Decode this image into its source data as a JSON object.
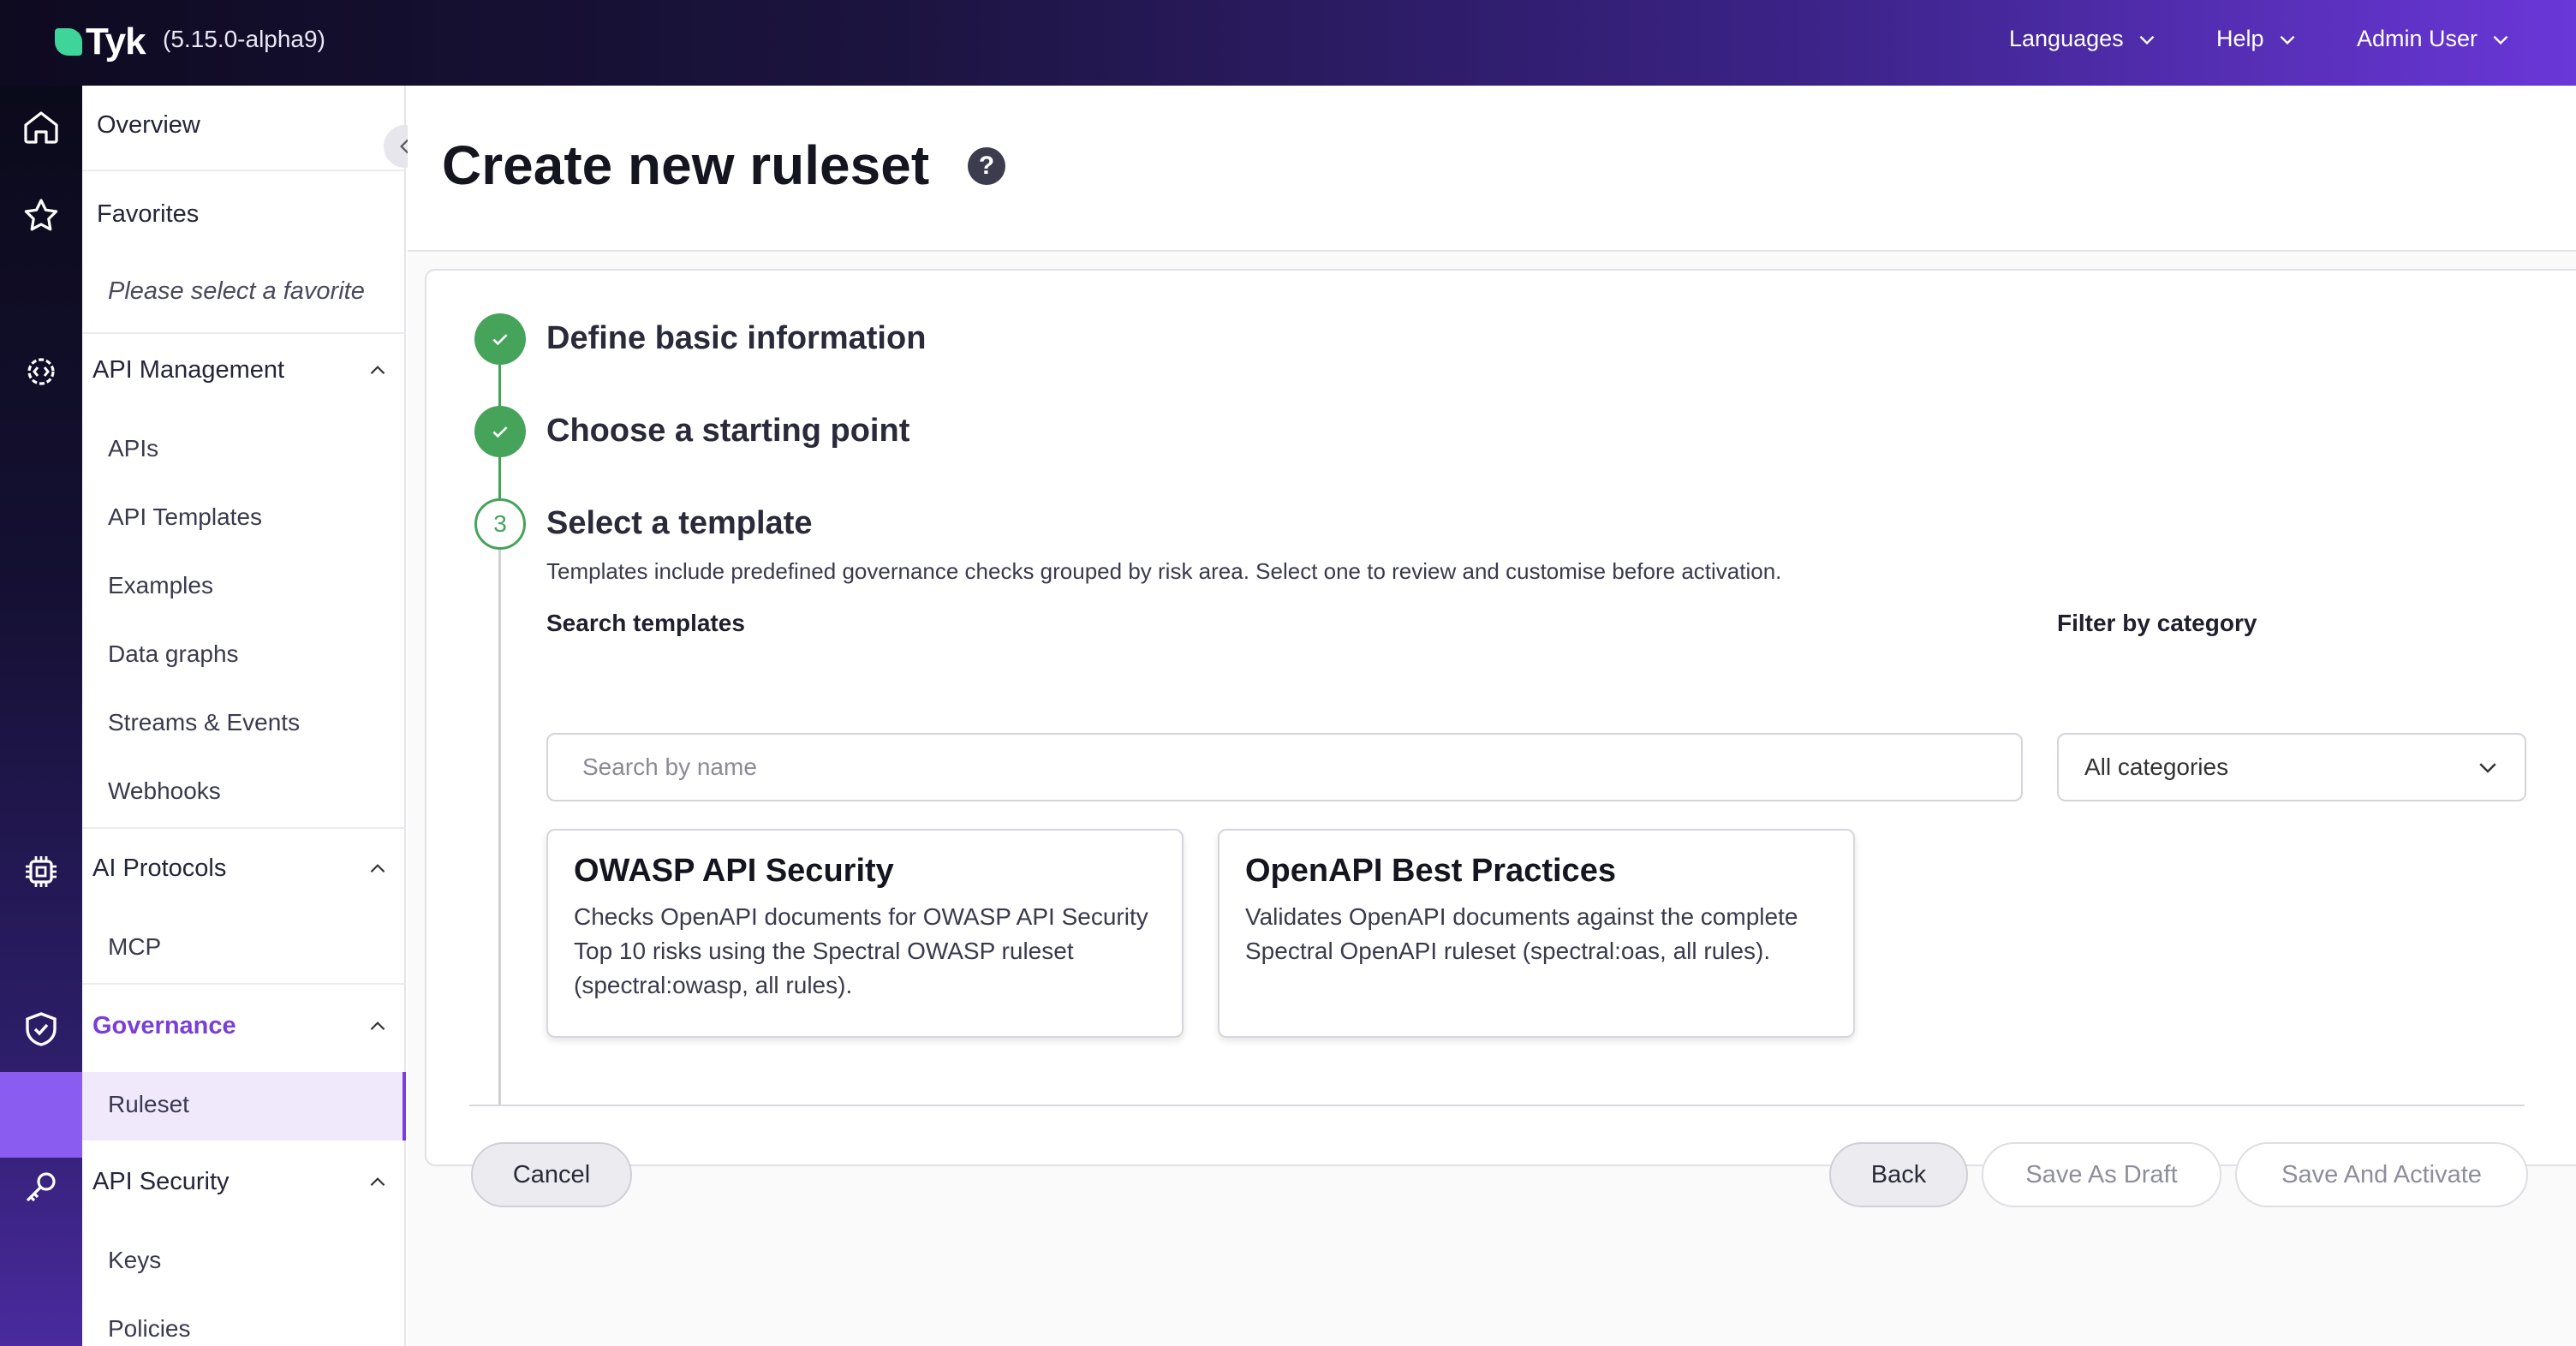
{
  "topbar": {
    "logo_text": "Tyk",
    "version": "(5.15.0-alpha9)",
    "languages_label": "Languages",
    "help_label": "Help",
    "user_label": "Admin User"
  },
  "rail": {
    "icons": [
      "home-icon",
      "star-icon",
      "gear-code-icon",
      "chip-icon",
      "shield-check-icon",
      "key-icon"
    ]
  },
  "sidebar": {
    "overview": "Overview",
    "favorites": "Favorites",
    "favorites_placeholder": "Please select a favorite",
    "api_management": {
      "label": "API Management",
      "items": [
        "APIs",
        "API Templates",
        "Examples",
        "Data graphs",
        "Streams & Events",
        "Webhooks"
      ]
    },
    "ai_protocols": {
      "label": "AI Protocols",
      "items": [
        "MCP"
      ]
    },
    "governance": {
      "label": "Governance",
      "items": [
        "Ruleset"
      ]
    },
    "api_security": {
      "label": "API Security",
      "items": [
        "Keys",
        "Policies"
      ]
    }
  },
  "page": {
    "title": "Create new ruleset",
    "help": "?"
  },
  "steps": [
    {
      "title": "Define basic information",
      "status": "done"
    },
    {
      "title": "Choose a starting point",
      "status": "done"
    },
    {
      "number": "3",
      "title": "Select a template",
      "status": "current",
      "description": "Templates include predefined governance checks grouped by risk area. Select one to review and customise before activation."
    }
  ],
  "search": {
    "label": "Search templates",
    "placeholder": "Search by name"
  },
  "filter": {
    "label": "Filter by category",
    "value": "All categories"
  },
  "templates": [
    {
      "title": "OWASP API Security",
      "description": "Checks OpenAPI documents for OWASP API Security Top 10 risks using the Spectral OWASP ruleset (spectral:owasp, all rules)."
    },
    {
      "title": "OpenAPI Best Practices",
      "description": "Validates OpenAPI documents against the complete Spectral OpenAPI ruleset (spectral:oas, all rules)."
    }
  ],
  "actions": {
    "cancel": "Cancel",
    "back": "Back",
    "save_draft": "Save As Draft",
    "save_activate": "Save And Activate"
  },
  "colors": {
    "accent": "#7a3fd6",
    "success": "#46a35a",
    "brand_leaf": "#3fd49a"
  }
}
